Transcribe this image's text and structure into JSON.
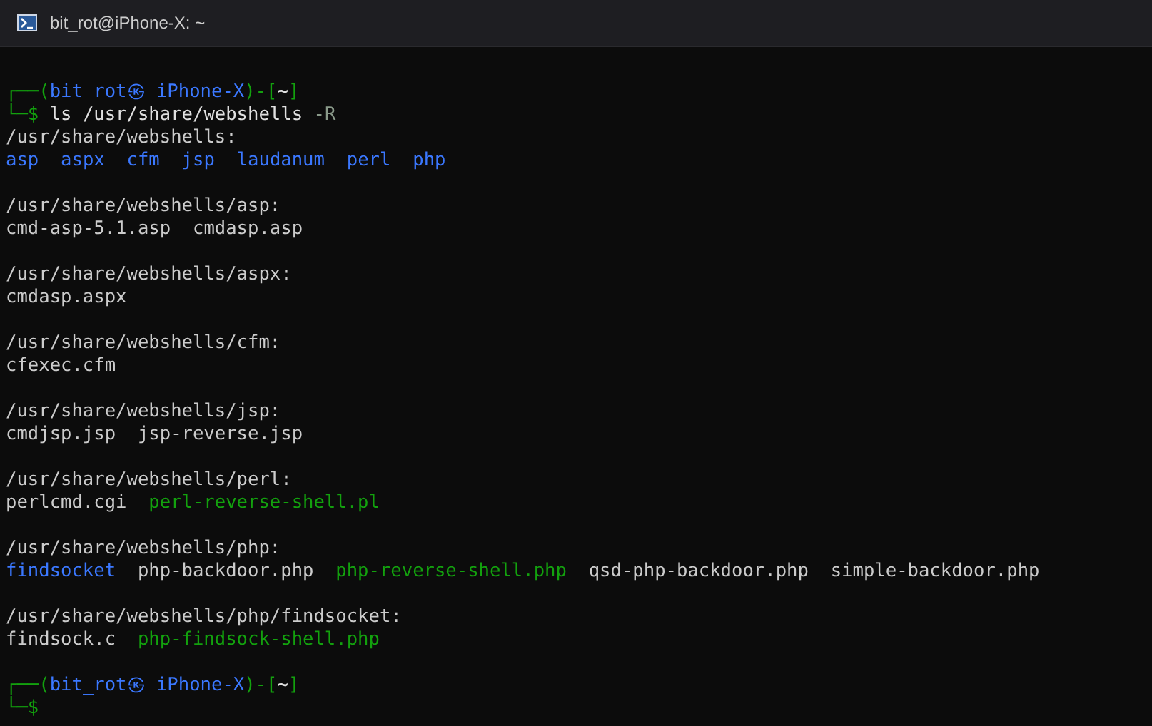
{
  "window": {
    "title": "bit_rot@iPhone-X: ~"
  },
  "lines": [
    {
      "kind": "blank"
    },
    {
      "kind": "prompt",
      "user": "bit_rot㉿ iPhone-X",
      "cwd": "~",
      "open": "┌──(",
      "mid": ")-[",
      "close": "]"
    },
    {
      "kind": "command",
      "mark": "└─$",
      "text": "ls /usr/share/webshells",
      "option": "-R"
    },
    {
      "kind": "output",
      "items": [
        {
          "text": "/usr/share/webshells:",
          "kind": "file"
        }
      ]
    },
    {
      "kind": "output",
      "items": [
        {
          "text": "asp",
          "kind": "dir"
        },
        {
          "text": "aspx",
          "kind": "dir"
        },
        {
          "text": "cfm",
          "kind": "dir"
        },
        {
          "text": "jsp",
          "kind": "dir"
        },
        {
          "text": "laudanum",
          "kind": "dir"
        },
        {
          "text": "perl",
          "kind": "dir"
        },
        {
          "text": "php",
          "kind": "dir"
        }
      ]
    },
    {
      "kind": "blank"
    },
    {
      "kind": "output",
      "items": [
        {
          "text": "/usr/share/webshells/asp:",
          "kind": "file"
        }
      ]
    },
    {
      "kind": "output",
      "items": [
        {
          "text": "cmd-asp-5.1.asp",
          "kind": "file"
        },
        {
          "text": "cmdasp.asp",
          "kind": "file"
        }
      ]
    },
    {
      "kind": "blank"
    },
    {
      "kind": "output",
      "items": [
        {
          "text": "/usr/share/webshells/aspx:",
          "kind": "file"
        }
      ]
    },
    {
      "kind": "output",
      "items": [
        {
          "text": "cmdasp.aspx",
          "kind": "file"
        }
      ]
    },
    {
      "kind": "blank"
    },
    {
      "kind": "output",
      "items": [
        {
          "text": "/usr/share/webshells/cfm:",
          "kind": "file"
        }
      ]
    },
    {
      "kind": "output",
      "items": [
        {
          "text": "cfexec.cfm",
          "kind": "file"
        }
      ]
    },
    {
      "kind": "blank"
    },
    {
      "kind": "output",
      "items": [
        {
          "text": "/usr/share/webshells/jsp:",
          "kind": "file"
        }
      ]
    },
    {
      "kind": "output",
      "items": [
        {
          "text": "cmdjsp.jsp",
          "kind": "file"
        },
        {
          "text": "jsp-reverse.jsp",
          "kind": "file"
        }
      ]
    },
    {
      "kind": "blank"
    },
    {
      "kind": "output",
      "items": [
        {
          "text": "/usr/share/webshells/perl:",
          "kind": "file"
        }
      ]
    },
    {
      "kind": "output",
      "items": [
        {
          "text": "perlcmd.cgi",
          "kind": "file"
        },
        {
          "text": "perl-reverse-shell.pl",
          "kind": "exec"
        }
      ]
    },
    {
      "kind": "blank"
    },
    {
      "kind": "output",
      "items": [
        {
          "text": "/usr/share/webshells/php:",
          "kind": "file"
        }
      ]
    },
    {
      "kind": "output",
      "items": [
        {
          "text": "findsocket",
          "kind": "dir"
        },
        {
          "text": "php-backdoor.php",
          "kind": "file"
        },
        {
          "text": "php-reverse-shell.php",
          "kind": "exec"
        },
        {
          "text": "qsd-php-backdoor.php",
          "kind": "file"
        },
        {
          "text": "simple-backdoor.php",
          "kind": "file"
        }
      ]
    },
    {
      "kind": "blank"
    },
    {
      "kind": "output",
      "items": [
        {
          "text": "/usr/share/webshells/php/findsocket:",
          "kind": "file"
        }
      ]
    },
    {
      "kind": "output",
      "items": [
        {
          "text": "findsock.c",
          "kind": "file"
        },
        {
          "text": "php-findsock-shell.php",
          "kind": "exec"
        }
      ]
    },
    {
      "kind": "blank"
    },
    {
      "kind": "prompt",
      "user": "bit_rot㉿ iPhone-X",
      "cwd": "~",
      "open": "┌──(",
      "mid": ")-[",
      "close": "]"
    },
    {
      "kind": "command",
      "mark": "└─$"
    }
  ]
}
